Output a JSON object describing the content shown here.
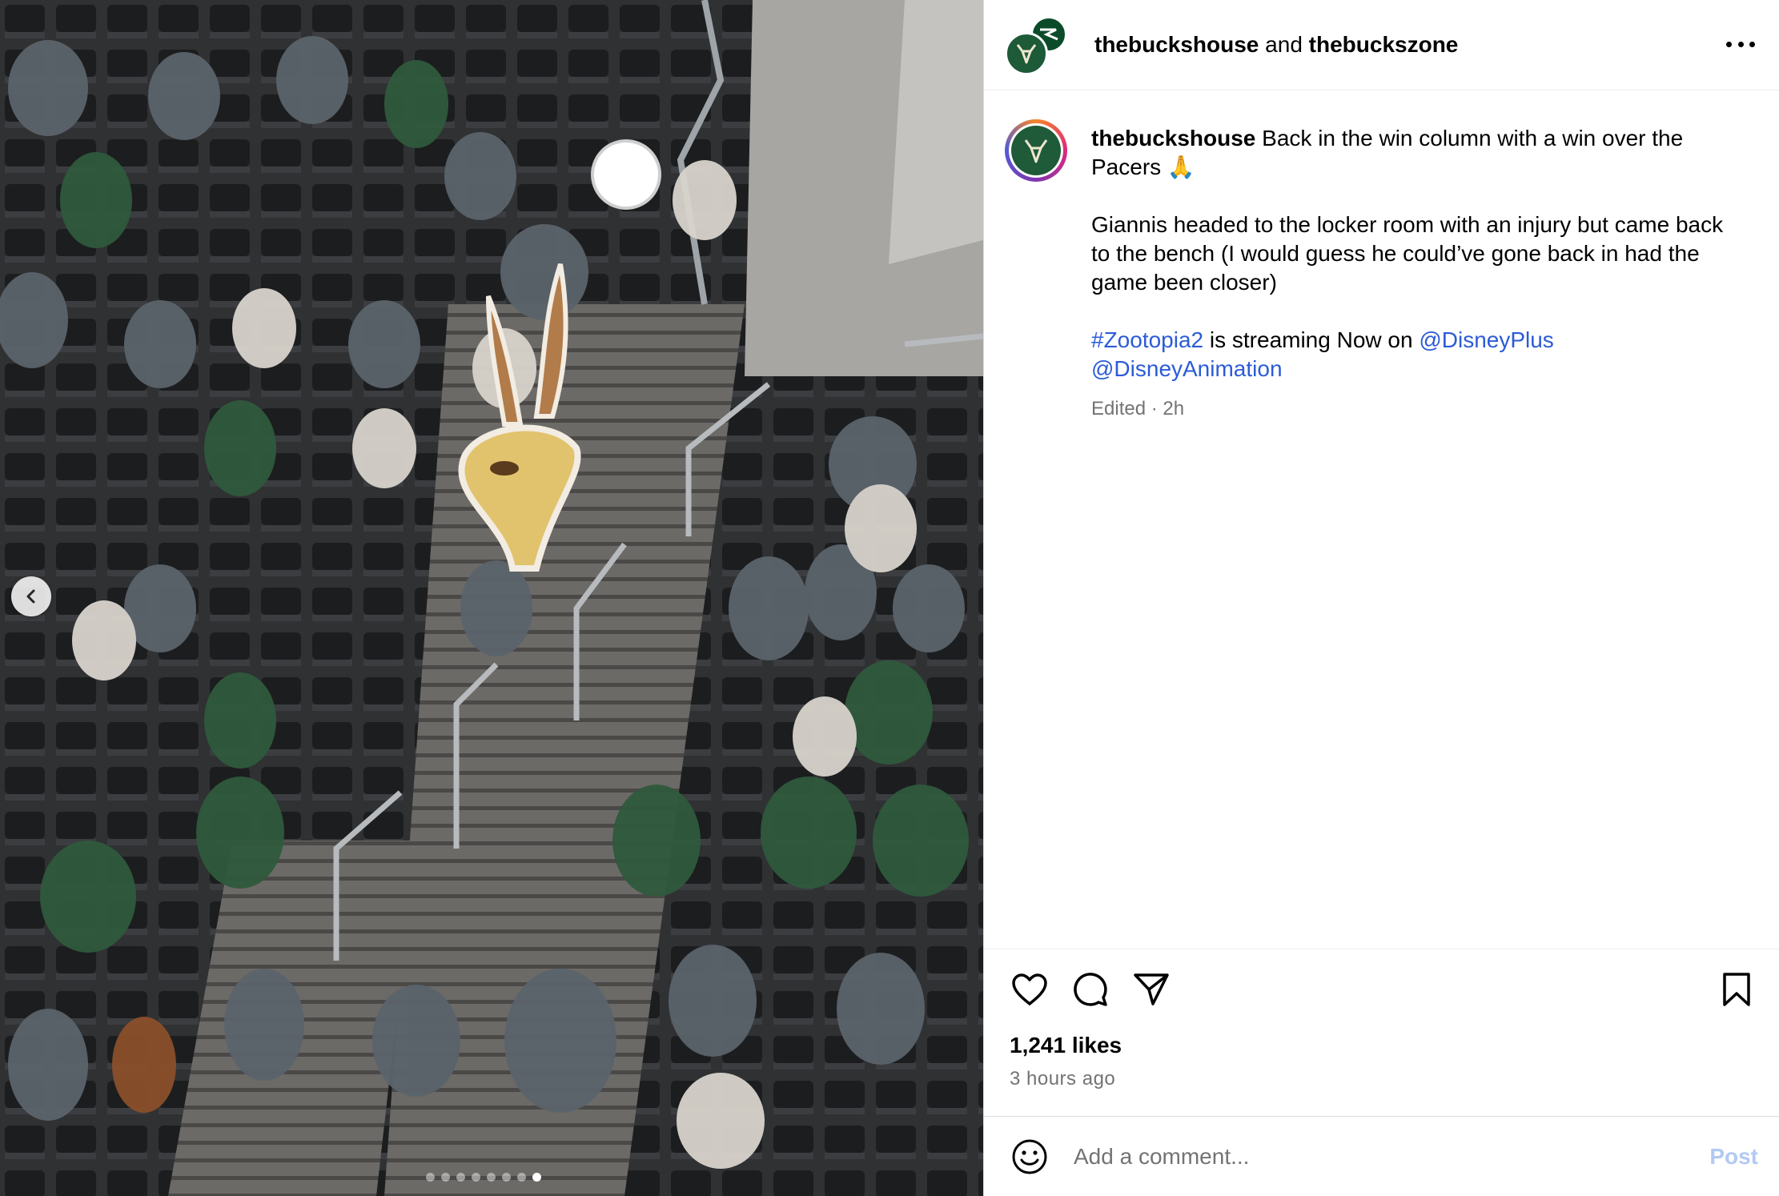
{
  "header": {
    "user1": "thebuckshouse",
    "joiner": "and",
    "user2": "thebuckszone"
  },
  "caption": {
    "username": "thebuckshouse",
    "line1": "Back in the win column with a win over the Pacers 🙏",
    "line2": "Giannis headed to the locker room with an injury but came back to the bench (I would guess he could’ve gone back in had the game been closer)",
    "hashtag": "#Zootopia2",
    "streaming_text": "is streaming Now on",
    "mention1": "@DisneyPlus",
    "mention2": "@DisneyAnimation",
    "edited": "Edited",
    "separator": "·",
    "age": "2h"
  },
  "stats": {
    "likes": "1,241 likes",
    "posted": "3 hours ago"
  },
  "comment": {
    "placeholder": "Add a comment...",
    "post_label": "Post"
  },
  "carousel": {
    "total": 8,
    "active_index": 8
  },
  "colors": {
    "bucks_green": "#1f5a39",
    "link_blue": "#2b5bd7",
    "muted_gray": "#737373",
    "post_disabled": "#b2c9f5"
  },
  "icons": [
    "chevron-left-icon",
    "more-icon",
    "heart-icon",
    "comment-icon",
    "share-icon",
    "bookmark-icon",
    "emoji-icon"
  ]
}
